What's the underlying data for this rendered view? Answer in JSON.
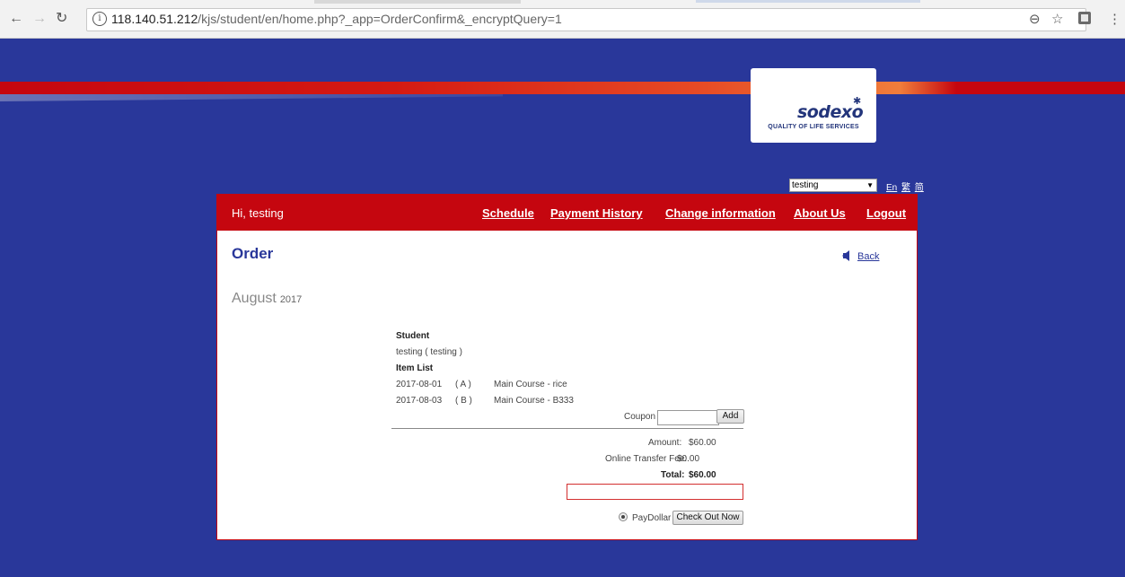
{
  "browser": {
    "url_host": "118.140.51.212",
    "url_path": "/kjs/student/en/home.php?_app=OrderConfirm&_encryptQuery=1"
  },
  "logo": {
    "word": "sodexo",
    "tagline": "QUALITY OF LIFE SERVICES"
  },
  "lang": {
    "selected": "testing",
    "links": [
      "En",
      "繁",
      "简"
    ]
  },
  "nav": {
    "greeting": "Hi, testing",
    "links": [
      "Schedule",
      "Payment History",
      "Change information",
      "About Us",
      "Logout"
    ]
  },
  "page": {
    "title": "Order",
    "back": "Back",
    "month": "August",
    "year": "2017"
  },
  "order": {
    "student_label": "Student",
    "student_value": "testing ( testing )",
    "items_label": "Item List",
    "items": [
      {
        "date": "2017-08-01",
        "code": "( A )",
        "desc": "Main Course - rice"
      },
      {
        "date": "2017-08-03",
        "code": "( B )",
        "desc": "Main Course - B333"
      }
    ],
    "coupon_label": "Coupon",
    "coupon_value": "",
    "add_label": "Add",
    "amount_label": "Amount:",
    "amount_value": "$60.00",
    "fee_label": "Online Transfer Fee:",
    "fee_value": "$0.00",
    "total_label": "Total:",
    "total_value": "$60.00",
    "payment_method": "PayDollar",
    "checkout_label": "Check Out Now"
  },
  "colors": {
    "background": "#29379a",
    "accent_red": "#c5060f"
  }
}
